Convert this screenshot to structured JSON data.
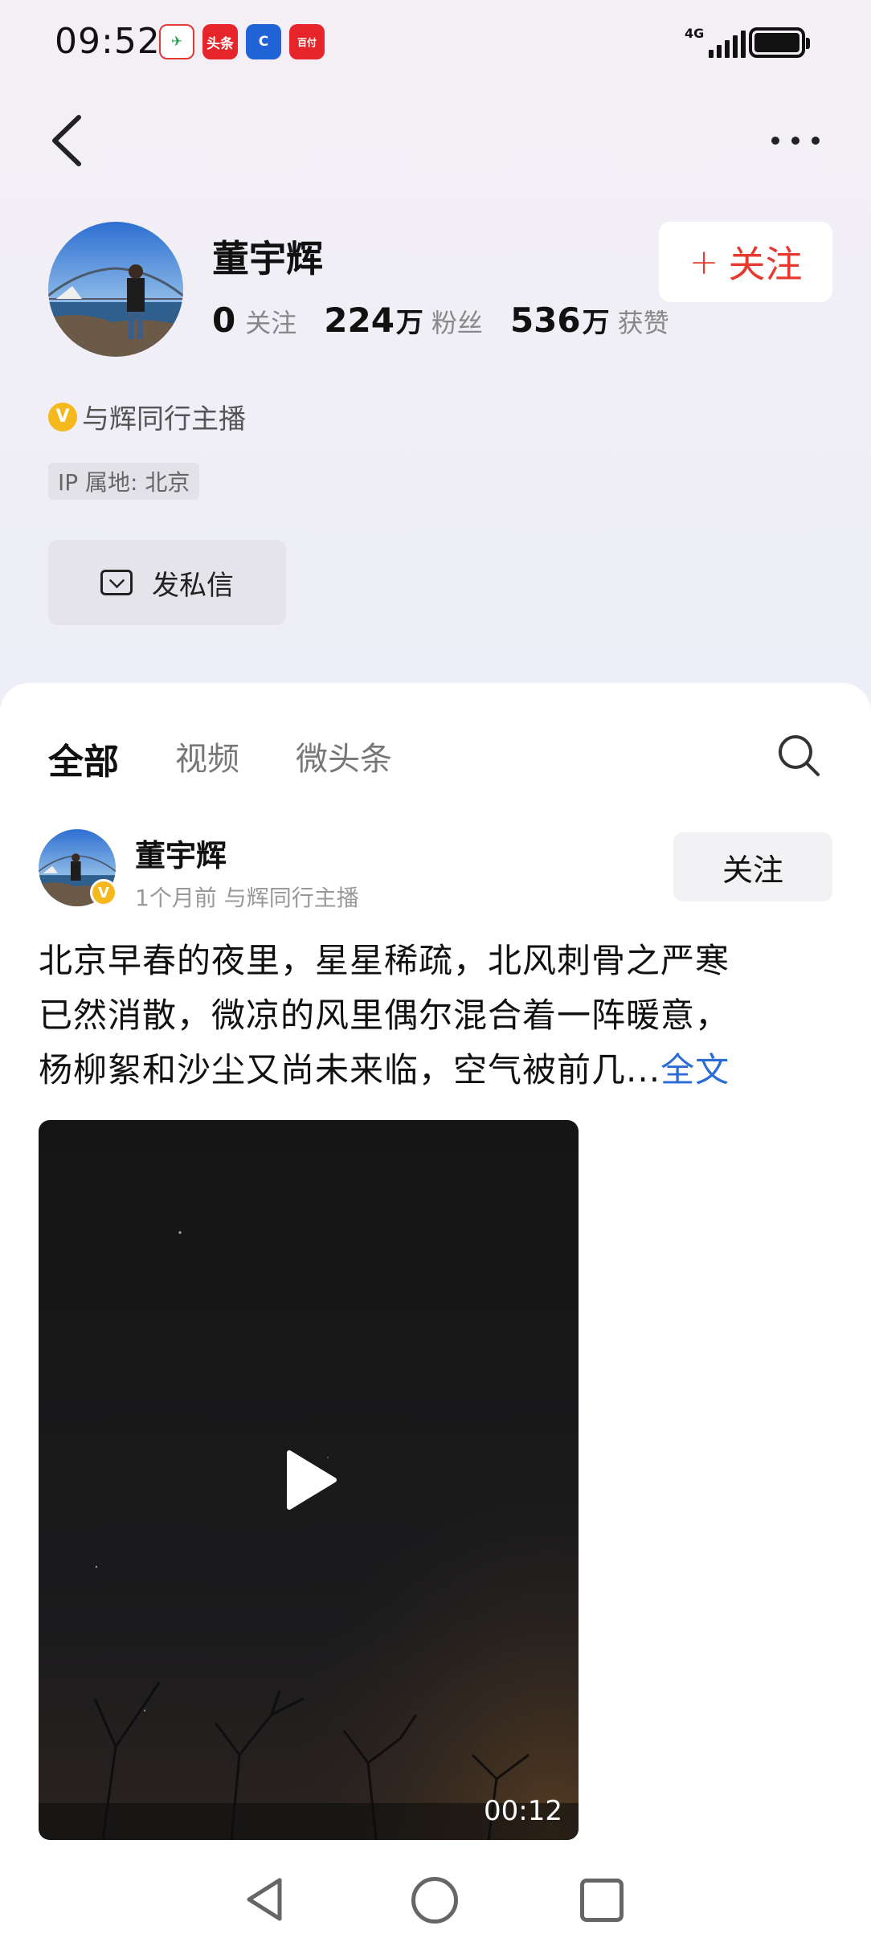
{
  "status_bar": {
    "time": "09:52",
    "apps": [
      {
        "name": "china-mobile-icon",
        "text": ""
      },
      {
        "name": "toutiao-icon",
        "text": "头条"
      },
      {
        "name": "ccb-icon",
        "text": "C"
      },
      {
        "name": "baipay-icon",
        "text": "百付"
      }
    ],
    "network": "4G"
  },
  "profile": {
    "name": "董宇辉",
    "stats": [
      {
        "num": "0",
        "unit": "",
        "label": "关注"
      },
      {
        "num": "224",
        "unit": "万",
        "label": "粉丝"
      },
      {
        "num": "536",
        "unit": "万",
        "label": "获赞"
      }
    ],
    "follow_label": "关注",
    "verify_badge": "V",
    "verify_text": "与辉同行主播",
    "ip_location": "IP 属地: 北京",
    "dm_label": "发私信"
  },
  "tabs": [
    {
      "label": "全部",
      "active": true
    },
    {
      "label": "视频",
      "active": false
    },
    {
      "label": "微头条",
      "active": false
    }
  ],
  "post": {
    "author": "董宇辉",
    "meta": "1个月前 与辉同行主播",
    "follow_label": "关注",
    "text_lines": [
      "北京早春的夜里，星星稀疏，北风刺骨之严寒",
      "已然消散，微凉的风里偶尔混合着一阵暖意，",
      "杨柳絮和沙尘又尚未来临，空气被前几"
    ],
    "ellipsis": "...",
    "fulltext_label": "全文",
    "video_duration": "00:12"
  },
  "colors": {
    "accent_red": "#e8392f",
    "link_blue": "#2a6bd6",
    "verify_gold": "#f5b81d"
  }
}
